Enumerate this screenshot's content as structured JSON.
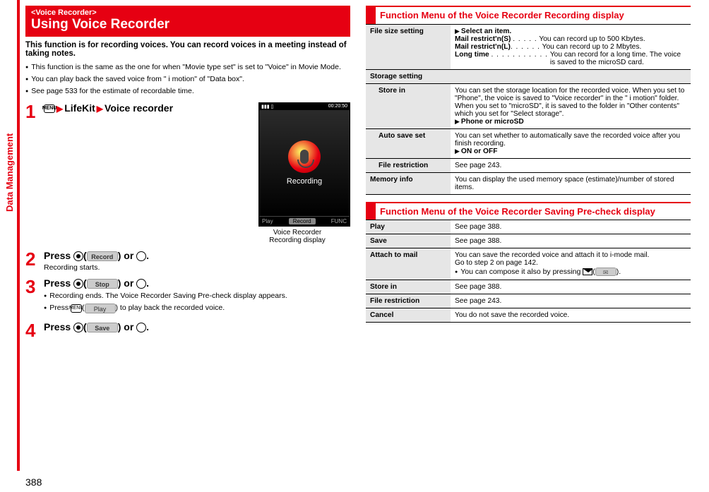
{
  "sideTab": "Data Management",
  "pageNumber": "388",
  "left": {
    "banner": {
      "sub": "<Voice Recorder>",
      "main": "Using Voice Recorder"
    },
    "intro": "This function is for recording voices. You can record voices in a meeting instead of taking notes.",
    "bullets": [
      "This function is the same as the one for when \"Movie type set\" is set to \"Voice\" in Movie Mode.",
      "You can play back the saved voice from \" i motion\" of \"Data box\".",
      "See page 533 for the estimate of recordable time."
    ],
    "step1": {
      "menuKey": "MENU",
      "part1": "LifeKit",
      "part2": "Voice recorder"
    },
    "phone": {
      "statusLeft": "▮▮▮ ▯",
      "statusRight": "00:20:50",
      "recordingLabel": "Recording",
      "softLeft": "Play",
      "softCenter": "Record",
      "softRight": "FUNC",
      "captionLine1": "Voice Recorder",
      "captionLine2": "Recording display"
    },
    "step2": {
      "title_a": "Press",
      "soft": "Record",
      "title_b": "or",
      "title_c": ".",
      "sub": "Recording starts."
    },
    "step3": {
      "title_a": "Press",
      "soft": "Stop",
      "title_b": "or",
      "title_c": ".",
      "bullets": [
        "Recording ends. The Voice Recorder Saving Pre-check display appears."
      ],
      "playLine_a": "Press",
      "playMenu": "MENU",
      "playSoft": "Play",
      "playLine_b": ") to play back the recorded voice."
    },
    "step4": {
      "title_a": "Press",
      "soft": "Save",
      "title_b": "or",
      "title_c": "."
    }
  },
  "right": {
    "section1": {
      "title": "Function Menu of the Voice Recorder Recording display",
      "fileSize": {
        "label": "File size setting",
        "prompt": "Select an item.",
        "r1a": "Mail restrict'n(S)",
        "r1b": "You can record up to 500 Kbytes.",
        "r2a": "Mail restrict'n(L)",
        "r2b": "You can record up to 2 Mbytes.",
        "r3a": "Long time",
        "r3b": "You can record for a long time. The voice is saved to the microSD card."
      },
      "storageHeader": "Storage setting",
      "storeIn": {
        "label": "Store in",
        "body": "You can set the storage location for the recorded voice. When you set to \"Phone\", the voice is saved to \"Voice recorder\" in the \" i motion\" folder. When you set to \"microSD\", it is saved to the folder in \"Other contents\" which you set for \"Select storage\".",
        "choice": "Phone or microSD"
      },
      "autoSave": {
        "label": "Auto save set",
        "body": "You can set whether to automatically save the recorded voice after you finish recording.",
        "choice": "ON or OFF"
      },
      "fileRestriction": {
        "label": "File restriction",
        "body": "See page 243."
      },
      "memoryInfo": {
        "label": "Memory info",
        "body": "You can display the used memory space (estimate)/number of stored items."
      }
    },
    "section2": {
      "title": "Function Menu of the Voice Recorder Saving Pre-check display",
      "rows": {
        "play": {
          "label": "Play",
          "body": "See page 388."
        },
        "save": {
          "label": "Save",
          "body": "See page 388."
        },
        "attach": {
          "label": "Attach to mail",
          "line1": "You can save the recorded voice and attach it to i-mode mail.",
          "line2": "Go to step 2 on page 142.",
          "bullet": "You can compose it also by pressing",
          "bulletEnd": ")."
        },
        "storeIn": {
          "label": "Store in",
          "body": "See page 388."
        },
        "fileRestriction": {
          "label": "File restriction",
          "body": "See page 243."
        },
        "cancel": {
          "label": "Cancel",
          "body": "You do not save the recorded voice."
        }
      }
    }
  }
}
